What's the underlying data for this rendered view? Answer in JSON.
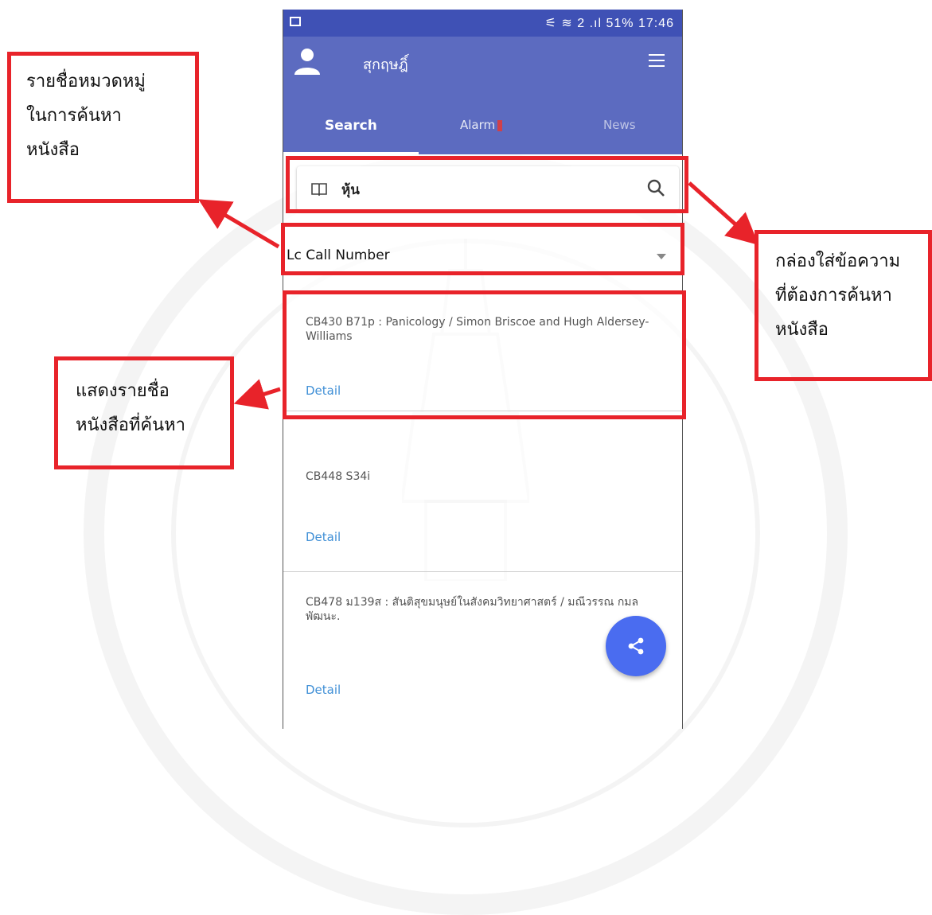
{
  "status_bar": {
    "icons": "⚟ ≋ 2 .ıl",
    "battery": "51%",
    "time": "17:46"
  },
  "app_bar": {
    "title": "สุกฤษฎิ์"
  },
  "tabs": [
    {
      "label": "Search",
      "selected": true
    },
    {
      "label": "Alarm",
      "badge": "0"
    },
    {
      "label": "News"
    }
  ],
  "search": {
    "value": "หุ้น"
  },
  "category": {
    "selected": "Lc Call Number"
  },
  "results": [
    {
      "title": "CB430 B71p  : Panicology / Simon Briscoe and Hugh Aldersey-Williams",
      "detail": "Detail"
    },
    {
      "title": "CB448 S34i",
      "detail": "Detail"
    },
    {
      "title": "CB478 ม139ส  : สันติสุขมนุษย์ในสังคมวิทยาศาสตร์ / มณีวรรณ กมลพัฒนะ.",
      "detail": "Detail"
    }
  ],
  "annotations": {
    "category_list": [
      "รายชื่อหมวดหมู่",
      "ในการค้นหา",
      "หนังสือ"
    ],
    "search_box": [
      "กล่องใส่ข้อความ",
      "ที่ต้องการค้นหา",
      "หนังสือ"
    ],
    "results_list": [
      "แสดงรายชื่อ",
      "หนังสือที่ค้นหา"
    ]
  },
  "colors": {
    "primary": "#5c6bc0",
    "status_bar": "#3f51b5",
    "accent_fab": "#4a6cf0",
    "annotation_red": "#e8232a",
    "link": "#3f8fd6"
  }
}
